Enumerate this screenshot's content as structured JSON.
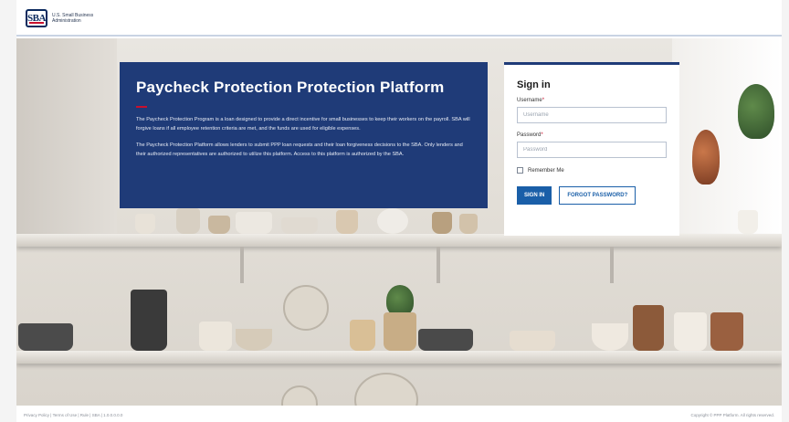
{
  "header": {
    "logo_mark": "SBA",
    "logo_text_line1": "U.S. Small Business",
    "logo_text_line2": "Administration"
  },
  "info": {
    "title": "Paycheck Protection Protection Platform",
    "paragraph1": "The Paycheck Protection Program is a loan designed to provide a direct incentive for small businesses to keep their workers on the payroll. SBA will forgive loans if all employee retention criteria are met, and the funds are used for eligible expenses.",
    "paragraph2": "The Paycheck Protection Platform allows lenders to submit PPP loan requests and their loan forgiveness decisions to the SBA. Only lenders and their authorized representatives are authorized to utilize this platform. Access to this platform is authorized by the SBA."
  },
  "signin": {
    "heading": "Sign in",
    "username_label": "Username",
    "username_placeholder": "Username",
    "password_label": "Password",
    "password_placeholder": "Password",
    "remember_label": "Remember Me",
    "signin_button": "SIGN IN",
    "forgot_button": "FORGOT PASSWORD?"
  },
  "footer": {
    "left": "Privacy Policy | Terms of Use | Rule | SBA | 1.0.0.0.0.0",
    "right": "Copyright © PPP Platform. All rights reserved."
  },
  "colors": {
    "panel_blue": "#1f3b78",
    "accent_red": "#c8102e",
    "button_blue": "#1a5fa8"
  }
}
